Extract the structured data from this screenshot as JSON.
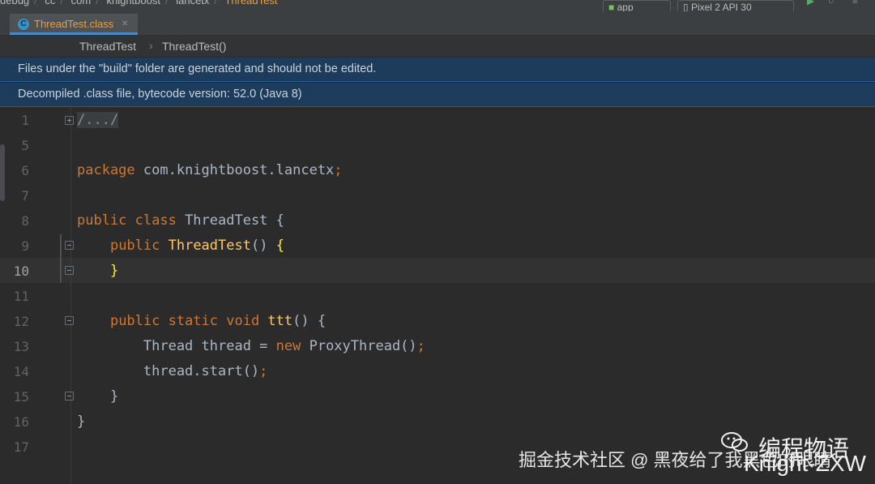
{
  "top_nav": {
    "crumbs": [
      "debug",
      "cc",
      "com",
      "knightboost",
      "lancetx"
    ],
    "active": "ThreadTest",
    "run_config": "app",
    "device": "Pixel 2 API 30"
  },
  "tab": {
    "icon_letter": "C",
    "label": "ThreadTest.class",
    "close": "×"
  },
  "breadcrumbs": {
    "class": "ThreadTest",
    "separator": "›",
    "method": "ThreadTest()"
  },
  "banners": {
    "build_warning": "Files under the \"build\" folder are generated and should not be edited.",
    "decompiled_info": "Decompiled .class file, bytecode version: 52.0 (Java 8)"
  },
  "editor": {
    "lines": [
      {
        "num": "1",
        "tokens": [
          {
            "c": "fold",
            "t": "/.../"
          }
        ]
      },
      {
        "num": "5",
        "tokens": []
      },
      {
        "num": "6",
        "tokens": [
          {
            "c": "kw",
            "t": "package "
          },
          {
            "c": "plain",
            "t": "com.knightboost.lancetx"
          },
          {
            "c": "kw",
            "t": ";"
          }
        ]
      },
      {
        "num": "7",
        "tokens": []
      },
      {
        "num": "8",
        "tokens": [
          {
            "c": "kw",
            "t": "public class "
          },
          {
            "c": "plain",
            "t": "ThreadTest {"
          }
        ]
      },
      {
        "num": "9",
        "tokens": [
          {
            "c": "plain",
            "t": "    "
          },
          {
            "c": "kw",
            "t": "public "
          },
          {
            "c": "fn",
            "t": "ThreadTest"
          },
          {
            "c": "plain",
            "t": "() "
          },
          {
            "c": "brace-hl",
            "t": "{"
          }
        ]
      },
      {
        "num": "10",
        "tokens": [
          {
            "c": "plain",
            "t": "    "
          },
          {
            "c": "brace-hl",
            "t": "}"
          }
        ]
      },
      {
        "num": "11",
        "tokens": []
      },
      {
        "num": "12",
        "tokens": [
          {
            "c": "plain",
            "t": "    "
          },
          {
            "c": "kw",
            "t": "public static void "
          },
          {
            "c": "fn",
            "t": "ttt"
          },
          {
            "c": "plain",
            "t": "() {"
          }
        ]
      },
      {
        "num": "13",
        "tokens": [
          {
            "c": "plain",
            "t": "        Thread thread = "
          },
          {
            "c": "kw",
            "t": "new "
          },
          {
            "c": "plain",
            "t": "ProxyThread()"
          },
          {
            "c": "kw",
            "t": ";"
          }
        ]
      },
      {
        "num": "14",
        "tokens": [
          {
            "c": "plain",
            "t": "        thread.start()"
          },
          {
            "c": "kw",
            "t": ";"
          }
        ]
      },
      {
        "num": "15",
        "tokens": [
          {
            "c": "plain",
            "t": "    }"
          }
        ]
      },
      {
        "num": "16",
        "tokens": [
          {
            "c": "plain",
            "t": "}"
          }
        ]
      },
      {
        "num": "17",
        "tokens": []
      }
    ],
    "current_line": "10"
  },
  "watermark": {
    "caption": "掘金技术社区 @ 黑夜给了我黑色的眼睛",
    "brand": "编程物语",
    "author": "Knight-ZXW"
  }
}
